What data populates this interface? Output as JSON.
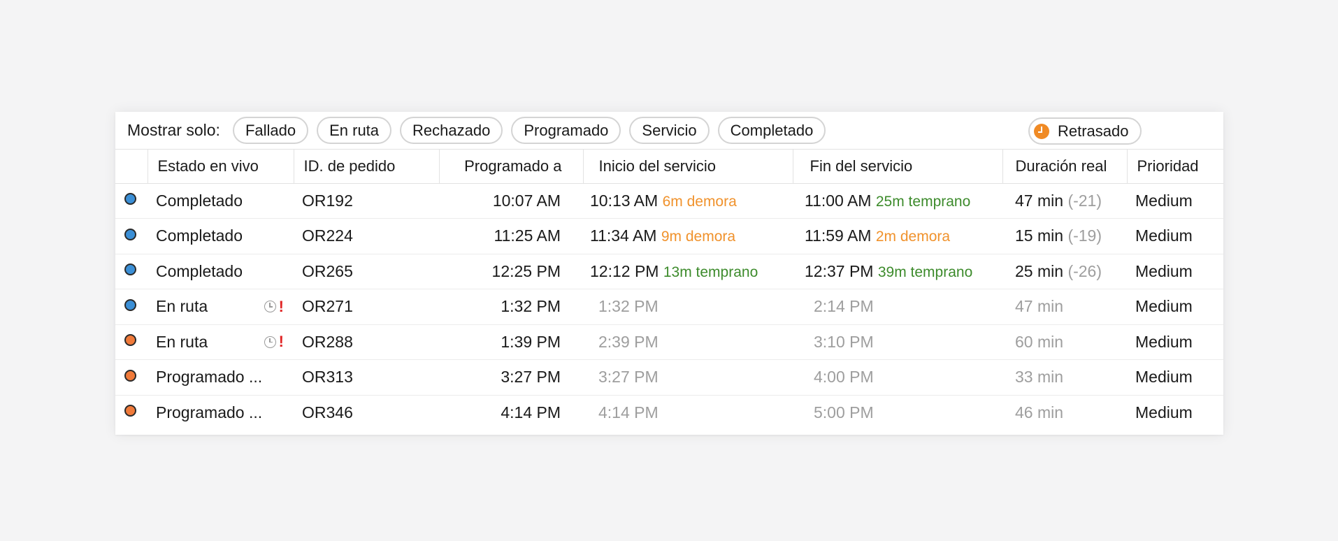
{
  "filter": {
    "label": "Mostrar solo:",
    "chips": [
      "Fallado",
      "En ruta",
      "Rechazado",
      "Programado",
      "Servicio",
      "Completado"
    ],
    "delayed_chip": "Retrasado"
  },
  "table": {
    "headers": [
      "Estado en vivo",
      "ID. de pedido",
      "Programado a",
      "Inicio del servicio",
      "Fin del servicio",
      "Duración real",
      "Prioridad"
    ],
    "status_colors": {
      "blue": "#3b8fd6",
      "orange": "#f07a3a"
    },
    "rows": [
      {
        "dot": "blue",
        "estado": "Completado",
        "icons": false,
        "id": "OR192",
        "programado": "10:07 AM",
        "inicio": "10:13 AM",
        "inicio_note": "6m demora",
        "inicio_note_color": "orange",
        "fin": "11:00 AM",
        "fin_note": "25m temprano",
        "fin_note_color": "green",
        "duracion": "47 min",
        "duracion_delta": "(-21)",
        "prioridad": "Medium",
        "actual": true
      },
      {
        "dot": "blue",
        "estado": "Completado",
        "icons": false,
        "id": "OR224",
        "programado": "11:25 AM",
        "inicio": "11:34 AM",
        "inicio_note": "9m demora",
        "inicio_note_color": "orange",
        "fin": "11:59 AM",
        "fin_note": "2m demora",
        "fin_note_color": "orange",
        "duracion": "15 min",
        "duracion_delta": "(-19)",
        "prioridad": "Medium",
        "actual": true
      },
      {
        "dot": "blue",
        "estado": "Completado",
        "icons": false,
        "id": "OR265",
        "programado": "12:25 PM",
        "inicio": "12:12 PM",
        "inicio_note": "13m temprano",
        "inicio_note_color": "green",
        "fin": "12:37 PM",
        "fin_note": "39m temprano",
        "fin_note_color": "green",
        "duracion": "25 min",
        "duracion_delta": "(-26)",
        "prioridad": "Medium",
        "actual": true
      },
      {
        "dot": "blue",
        "estado": "En ruta",
        "icons": true,
        "id": "OR271",
        "programado": "1:32 PM",
        "inicio": "1:32 PM",
        "inicio_note": "",
        "inicio_note_color": "",
        "fin": "2:14 PM",
        "fin_note": "",
        "fin_note_color": "",
        "duracion": "47 min",
        "duracion_delta": "",
        "prioridad": "Medium",
        "actual": false
      },
      {
        "dot": "orange",
        "estado": "En ruta",
        "icons": true,
        "id": "OR288",
        "programado": "1:39 PM",
        "inicio": "2:39 PM",
        "inicio_note": "",
        "inicio_note_color": "",
        "fin": "3:10 PM",
        "fin_note": "",
        "fin_note_color": "",
        "duracion": "60 min",
        "duracion_delta": "",
        "prioridad": "Medium",
        "actual": false
      },
      {
        "dot": "orange",
        "estado": "Programado ...",
        "icons": false,
        "id": "OR313",
        "programado": "3:27 PM",
        "inicio": "3:27 PM",
        "inicio_note": "",
        "inicio_note_color": "",
        "fin": "4:00 PM",
        "fin_note": "",
        "fin_note_color": "",
        "duracion": "33 min",
        "duracion_delta": "",
        "prioridad": "Medium",
        "actual": false
      },
      {
        "dot": "orange",
        "estado": "Programado ...",
        "icons": false,
        "id": "OR346",
        "programado": "4:14 PM",
        "inicio": "4:14 PM",
        "inicio_note": "",
        "inicio_note_color": "",
        "fin": "5:00 PM",
        "fin_note": "",
        "fin_note_color": "",
        "duracion": "46 min",
        "duracion_delta": "",
        "prioridad": "Medium",
        "actual": false
      }
    ]
  }
}
